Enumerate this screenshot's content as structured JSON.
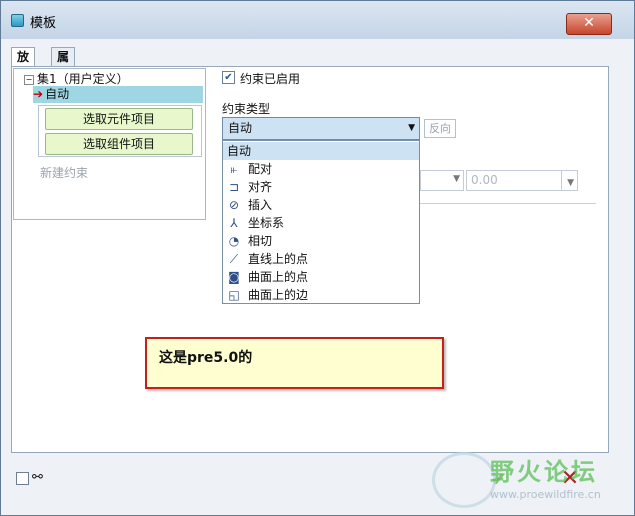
{
  "window": {
    "title": "模板",
    "close_label": "✕"
  },
  "tabs": [
    {
      "label": "放置",
      "active": true
    },
    {
      "label": "属性",
      "active": false
    }
  ],
  "tree": {
    "root_label": "集1（用户定义）",
    "selected_item": "自动",
    "pick_component": "选取元件项目",
    "pick_assembly": "选取组件项目",
    "new_constraint": "新建约束"
  },
  "constraint": {
    "enabled_label": "约束已启用",
    "enabled": true,
    "type_label": "约束类型",
    "type_value": "自动",
    "flip_label": "反向",
    "offset_value": "0.00"
  },
  "dropdown_options": [
    {
      "label": "自动",
      "icon": "none"
    },
    {
      "label": "配对",
      "icon": "mate-icon"
    },
    {
      "label": "对齐",
      "icon": "align-icon"
    },
    {
      "label": "插入",
      "icon": "insert-icon"
    },
    {
      "label": "坐标系",
      "icon": "csys-icon"
    },
    {
      "label": "相切",
      "icon": "tangent-icon"
    },
    {
      "label": "直线上的点",
      "icon": "point-on-line-icon"
    },
    {
      "label": "曲面上的点",
      "icon": "point-on-surface-icon"
    },
    {
      "label": "曲面上的边",
      "icon": "edge-on-surface-icon"
    }
  ],
  "annotation": "这是pre5.0的",
  "watermark": {
    "title": "野火论坛",
    "url": "www.proewildfire.cn"
  },
  "background_letters": "Y S",
  "colors": {
    "selection": "#9ed6e3",
    "green_button": "#e8f8cc",
    "note_border": "#c5201b",
    "note_bg": "#fefed0"
  }
}
